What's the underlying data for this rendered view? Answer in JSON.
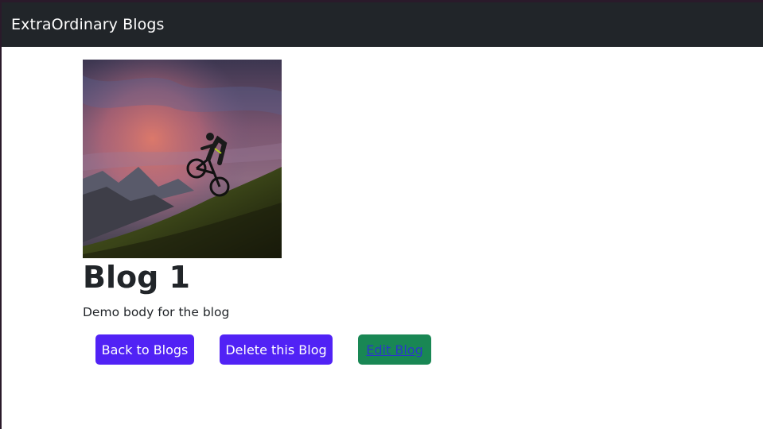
{
  "navbar": {
    "brand": "ExtraOrdinary Blogs"
  },
  "blog": {
    "image": "mountain-biker-at-sunset-photo",
    "title": "Blog 1",
    "body": "Demo body for the blog"
  },
  "actions": {
    "back_label": "Back to Blogs",
    "delete_label": "Delete this Blog",
    "edit_label": "Edit Blog"
  },
  "colors": {
    "navbar_bg": "#212529",
    "primary_button": "#5122f5",
    "edit_button": "#198754",
    "link": "#2a38c8"
  }
}
